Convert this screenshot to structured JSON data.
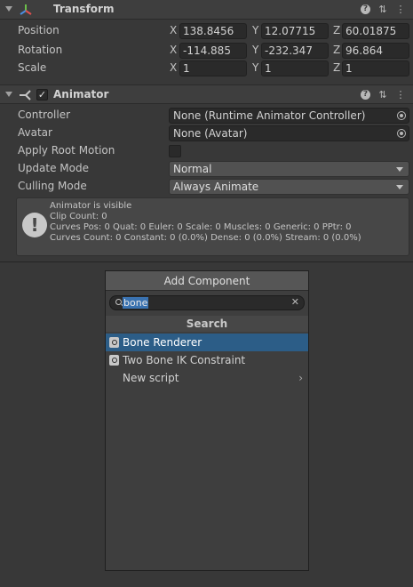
{
  "transform": {
    "title": "Transform",
    "icons": [
      "help-icon",
      "preset-icon",
      "more-icon"
    ],
    "position": {
      "label": "Position",
      "x": "138.8456",
      "y": "12.07715",
      "z": "60.01875"
    },
    "rotation": {
      "label": "Rotation",
      "x": "-114.885",
      "y": "-232.347",
      "z": "96.864"
    },
    "scale": {
      "label": "Scale",
      "x": "1",
      "y": "1",
      "z": "1"
    },
    "axis": {
      "x": "X",
      "y": "Y",
      "z": "Z"
    }
  },
  "animator": {
    "title": "Animator",
    "enabled": true,
    "controller": {
      "label": "Controller",
      "value": "None (Runtime Animator Controller)"
    },
    "avatar": {
      "label": "Avatar",
      "value": "None (Avatar)"
    },
    "apply_root_motion": {
      "label": "Apply Root Motion",
      "checked": false
    },
    "update_mode": {
      "label": "Update Mode",
      "value": "Normal"
    },
    "culling_mode": {
      "label": "Culling Mode",
      "value": "Always Animate"
    },
    "info": {
      "line1": "Animator is visible",
      "line2": "Clip Count: 0",
      "line3": "Curves Pos: 0 Quat: 0 Euler: 0 Scale: 0 Muscles: 0 Generic: 0 PPtr: 0",
      "line4": "Curves Count: 0 Constant: 0 (0.0%) Dense: 0 (0.0%) Stream: 0 (0.0%)"
    }
  },
  "add_component": {
    "title": "Add Component",
    "search_value": "bone",
    "section": "Search",
    "results": [
      {
        "label": "Bone Renderer",
        "selected": true
      },
      {
        "label": "Two Bone IK Constraint",
        "selected": false
      },
      {
        "label": "New script",
        "selected": false
      }
    ]
  },
  "colors": {
    "selection": "#2c5d87",
    "background": "#383838",
    "header": "#3e3e3e"
  }
}
